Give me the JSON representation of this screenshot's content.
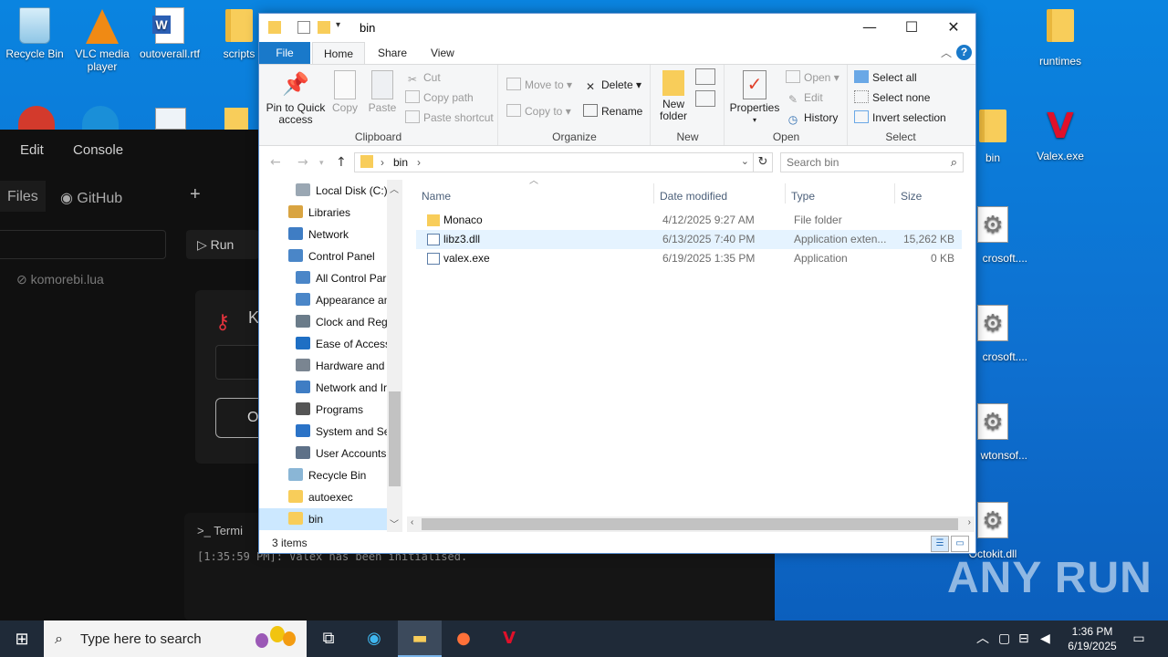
{
  "desktop": {
    "icons_left": [
      {
        "label": "Recycle Bin",
        "icon": "recycle-bin-icon"
      },
      {
        "label": "VLC media player",
        "icon": "vlc-icon"
      },
      {
        "label": "outoverall.rtf",
        "icon": "word-document-icon"
      },
      {
        "label": "scripts",
        "icon": "folder-icon"
      }
    ],
    "icons_right": [
      {
        "label": "runtimes",
        "icon": "folder-icon"
      },
      {
        "label": "bin",
        "icon": "folder-icon"
      },
      {
        "label": "Valex.exe",
        "icon": "valex-icon"
      },
      {
        "label": "crosoft....",
        "icon": "settings-file-icon"
      },
      {
        "label": "crosoft....",
        "icon": "settings-file-icon"
      },
      {
        "label": "wtonsof...",
        "icon": "settings-file-icon"
      },
      {
        "label": "Octokit.dll",
        "icon": "settings-file-icon"
      }
    ],
    "watermark": "ANY RUN"
  },
  "background_app": {
    "menu": [
      "Edit",
      "Console"
    ],
    "tab_files": "Files",
    "tab_github": "GitHub",
    "add_tab": "+",
    "run_label": "Run",
    "file_name": "komorebi.lua",
    "card_title": "K",
    "card_button": "O",
    "terminal_title": "Termi",
    "terminal_log": "[1:35:59 PM]: Valex has been initialised."
  },
  "explorer": {
    "title": "bin",
    "window_controls": {
      "minimize": "—",
      "maximize": "☐",
      "close": "✕"
    },
    "ribbon_tabs": [
      "File",
      "Home",
      "Share",
      "View"
    ],
    "active_tab": "Home",
    "help": "?",
    "clipboard": {
      "pin": "Pin to Quick access",
      "copy": "Copy",
      "paste": "Paste",
      "cut": "Cut",
      "copy_path": "Copy path",
      "paste_shortcut": "Paste shortcut",
      "label": "Clipboard"
    },
    "organize": {
      "move_to": "Move to",
      "copy_to": "Copy to",
      "delete": "Delete",
      "rename": "Rename",
      "label": "Organize"
    },
    "new": {
      "new_folder": "New folder",
      "label": "New"
    },
    "open": {
      "properties": "Properties",
      "open": "Open",
      "edit": "Edit",
      "history": "History",
      "label": "Open"
    },
    "select": {
      "select_all": "Select all",
      "select_none": "Select none",
      "invert": "Invert selection",
      "label": "Select"
    },
    "address": {
      "path": "bin",
      "search_placeholder": "Search bin"
    },
    "nav_pane": [
      {
        "label": "Local Disk (C:)",
        "indent": 2,
        "icon": "drive-icon"
      },
      {
        "label": "Libraries",
        "indent": 1,
        "icon": "libraries-icon"
      },
      {
        "label": "Network",
        "indent": 1,
        "icon": "network-icon"
      },
      {
        "label": "Control Panel",
        "indent": 1,
        "icon": "control-panel-icon"
      },
      {
        "label": "All Control Par",
        "indent": 2,
        "icon": "control-panel-icon"
      },
      {
        "label": "Appearance an",
        "indent": 2,
        "icon": "appearance-icon"
      },
      {
        "label": "Clock and Regi",
        "indent": 2,
        "icon": "clock-icon"
      },
      {
        "label": "Ease of Access",
        "indent": 2,
        "icon": "ease-of-access-icon"
      },
      {
        "label": "Hardware and",
        "indent": 2,
        "icon": "hardware-icon"
      },
      {
        "label": "Network and Ir",
        "indent": 2,
        "icon": "network-internet-icon"
      },
      {
        "label": "Programs",
        "indent": 2,
        "icon": "programs-icon"
      },
      {
        "label": "System and Sec",
        "indent": 2,
        "icon": "shield-icon"
      },
      {
        "label": "User Accounts",
        "indent": 2,
        "icon": "users-icon"
      },
      {
        "label": "Recycle Bin",
        "indent": 1,
        "icon": "recycle-bin-icon"
      },
      {
        "label": "autoexec",
        "indent": 1,
        "icon": "folder-icon"
      },
      {
        "label": "bin",
        "indent": 1,
        "icon": "folder-icon",
        "selected": true
      }
    ],
    "columns": [
      "Name",
      "Date modified",
      "Type",
      "Size"
    ],
    "files": [
      {
        "name": "Monaco",
        "date": "4/12/2025 9:27 AM",
        "type": "File folder",
        "size": "",
        "icon": "folder-icon"
      },
      {
        "name": "libz3.dll",
        "date": "6/13/2025 7:40 PM",
        "type": "Application exten...",
        "size": "15,262 KB",
        "icon": "dll-icon",
        "highlighted": true
      },
      {
        "name": "valex.exe",
        "date": "6/19/2025 1:35 PM",
        "type": "Application",
        "size": "0 KB",
        "icon": "exe-icon"
      }
    ],
    "status": "3 items"
  },
  "taskbar": {
    "search_placeholder": "Type here to search",
    "time": "1:36 PM",
    "date": "6/19/2025"
  }
}
